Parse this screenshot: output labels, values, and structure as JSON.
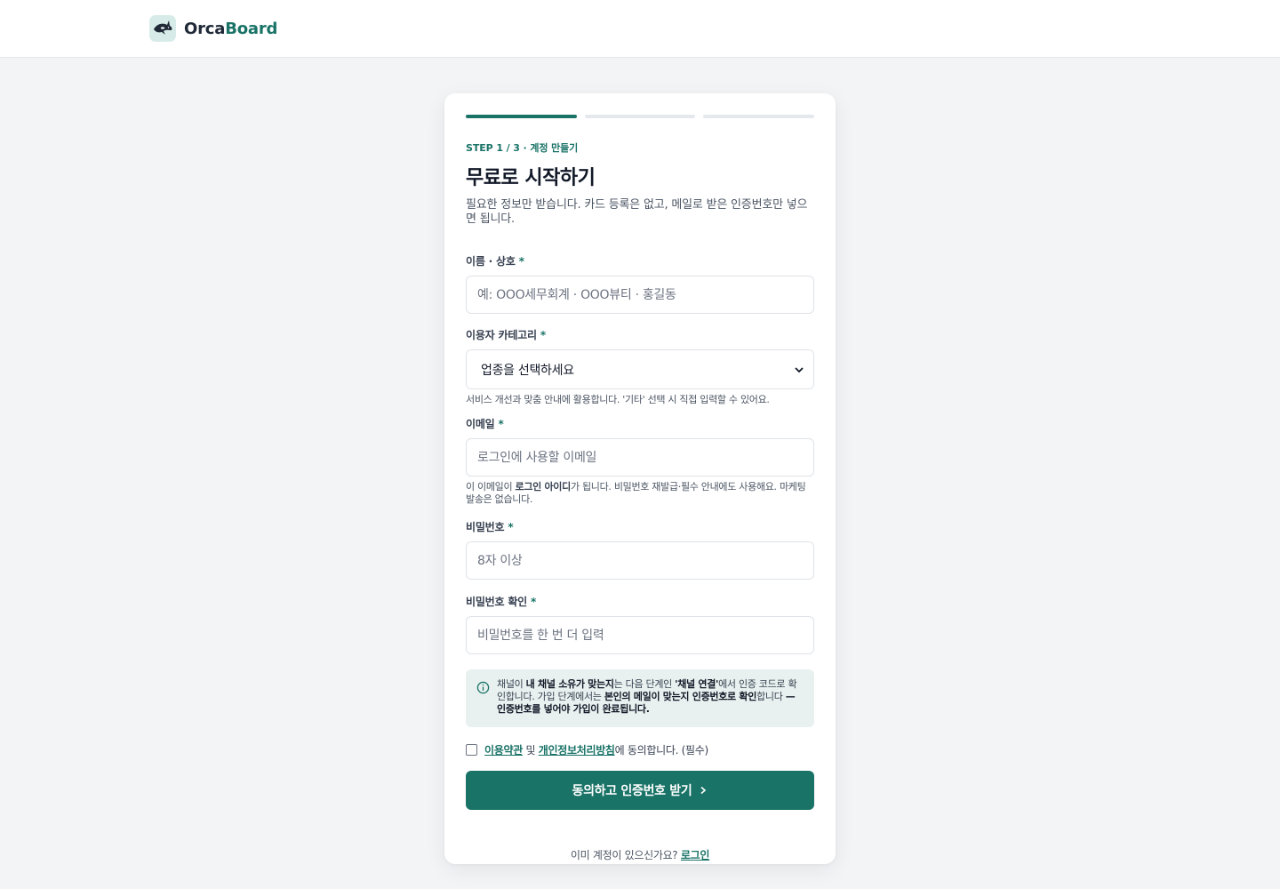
{
  "header": {
    "brand_primary": "Orca",
    "brand_accent": "Board",
    "logo_icon": "orca-whale-icon",
    "accent_color": "#1a7367"
  },
  "progress": {
    "current_step": 1,
    "total_steps": 3
  },
  "form": {
    "step_label": "STEP 1 / 3 · 계정 만들기",
    "title": "무료로 시작하기",
    "subtitle": "필요한 정보만 받습니다. 카드 등록은 없고, 메일로 받은 인증번호만 넣으면 됩니다.",
    "name": {
      "label": "이름 · 상호",
      "required": "*",
      "placeholder": "예: OOO세무회계 · OOO뷰티 · 홍길동"
    },
    "category": {
      "label": "이용자 카테고리",
      "required": "*",
      "selected": "업종을 선택하세요",
      "hint": "서비스 개선과 맞춤 안내에 활용합니다. '기타' 선택 시 직접 입력할 수 있어요."
    },
    "email": {
      "label": "이메일",
      "required": "*",
      "placeholder": "로그인에 사용할 이메일",
      "hint_pre": "이 이메일이 ",
      "hint_bold": "로그인 아이디",
      "hint_post": "가 됩니다. 비밀번호 재발급·필수 안내에도 사용해요. 마케팅 발송은 없습니다."
    },
    "password": {
      "label": "비밀번호",
      "required": "*",
      "placeholder": "8자 이상"
    },
    "password_confirm": {
      "label": "비밀번호 확인",
      "required": "*",
      "placeholder": "비밀번호를 한 번 더 입력"
    },
    "info": {
      "t1": "채널이 ",
      "b1": "내 채널 소유가 맞는지",
      "t2": "는 다음 단계인 ",
      "b2": "'채널 연결'",
      "t3": "에서 인증 코드로 확인합니다. 가입 단계에서는 ",
      "b3": "본인의 메일이 맞는지 인증번호로 확인",
      "t4": "합니다 ",
      "b4": "— 인증번호를 넣어야 가입이 완료됩니다."
    },
    "agree": {
      "terms": "이용약관",
      "and": " 및 ",
      "privacy": "개인정보처리방침",
      "suffix": "에 동의합니다. (필수)"
    },
    "submit_label": "동의하고 인증번호 받기",
    "login_prompt": "이미 계정이 있으신가요? ",
    "login_link": "로그인"
  }
}
